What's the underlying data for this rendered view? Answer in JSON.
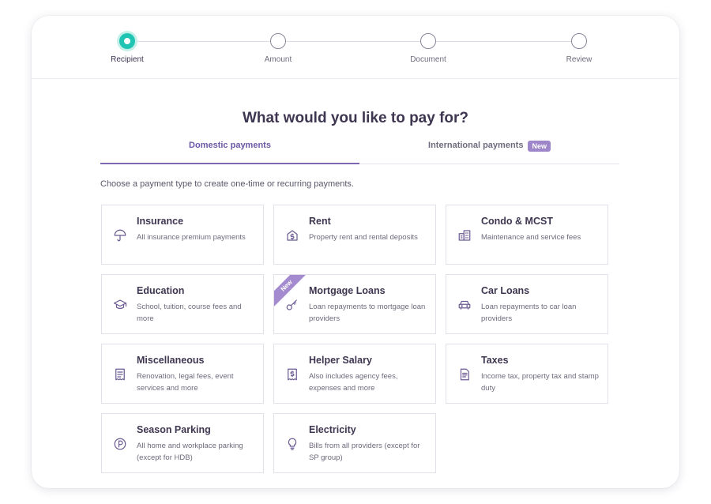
{
  "stepper": {
    "steps": [
      {
        "label": "Recipient",
        "active": true
      },
      {
        "label": "Amount",
        "active": false
      },
      {
        "label": "Document",
        "active": false
      },
      {
        "label": "Review",
        "active": false
      }
    ]
  },
  "heading": "What would you like to pay for?",
  "tabs": {
    "domestic": "Domestic payments",
    "international": "International payments",
    "international_badge": "New"
  },
  "intro": "Choose a payment type to create one-time or recurring payments.",
  "tiles": [
    {
      "icon": "umbrella-icon",
      "title": "Insurance",
      "desc": "All insurance premium payments"
    },
    {
      "icon": "house-dollar-icon",
      "title": "Rent",
      "desc": "Property rent and rental deposits"
    },
    {
      "icon": "building-icon",
      "title": "Condo & MCST",
      "desc": "Maintenance and service fees"
    },
    {
      "icon": "graduation-cap-icon",
      "title": "Education",
      "desc": "School, tuition, course fees and more"
    },
    {
      "icon": "key-icon",
      "title": "Mortgage Loans",
      "desc": "Loan repayments to mortgage loan providers",
      "ribbon": "New"
    },
    {
      "icon": "car-icon",
      "title": "Car Loans",
      "desc": "Loan repayments to car loan providers"
    },
    {
      "icon": "receipt-icon",
      "title": "Miscellaneous",
      "desc": "Renovation, legal fees, event services and more"
    },
    {
      "icon": "dollar-receipt-icon",
      "title": "Helper Salary",
      "desc": "Also includes agency fees, expenses and more"
    },
    {
      "icon": "document-icon",
      "title": "Taxes",
      "desc": "Income tax, property tax and stamp duty"
    },
    {
      "icon": "parking-icon",
      "title": "Season Parking",
      "desc": "All home and workplace parking (except for HDB)"
    },
    {
      "icon": "lightbulb-icon",
      "title": "Electricity",
      "desc": "Bills from all providers (except for SP group)"
    }
  ],
  "colors": {
    "accent": "#7e68b4",
    "step_active": "#1fc5b2",
    "text": "#3e3650",
    "icon": "#6b5a93"
  }
}
